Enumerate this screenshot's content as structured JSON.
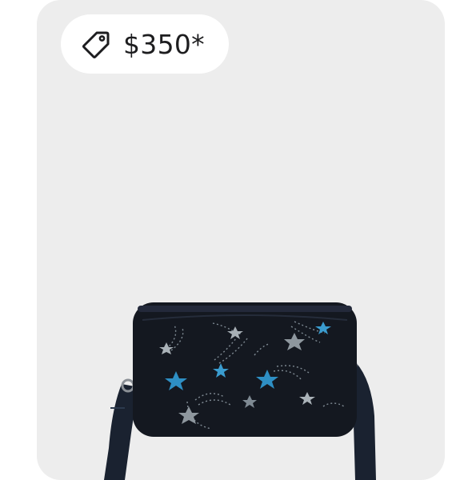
{
  "product_card": {
    "price": "$350*",
    "price_icon": "tag-icon",
    "image_description_icon": "crossbody-bag-image",
    "colors": {
      "card_background": "#ededed",
      "pill_background": "#ffffff",
      "bag_body": "#141820",
      "star_blue": "#2e8fc4",
      "star_grey": "#9aa3a8"
    }
  }
}
